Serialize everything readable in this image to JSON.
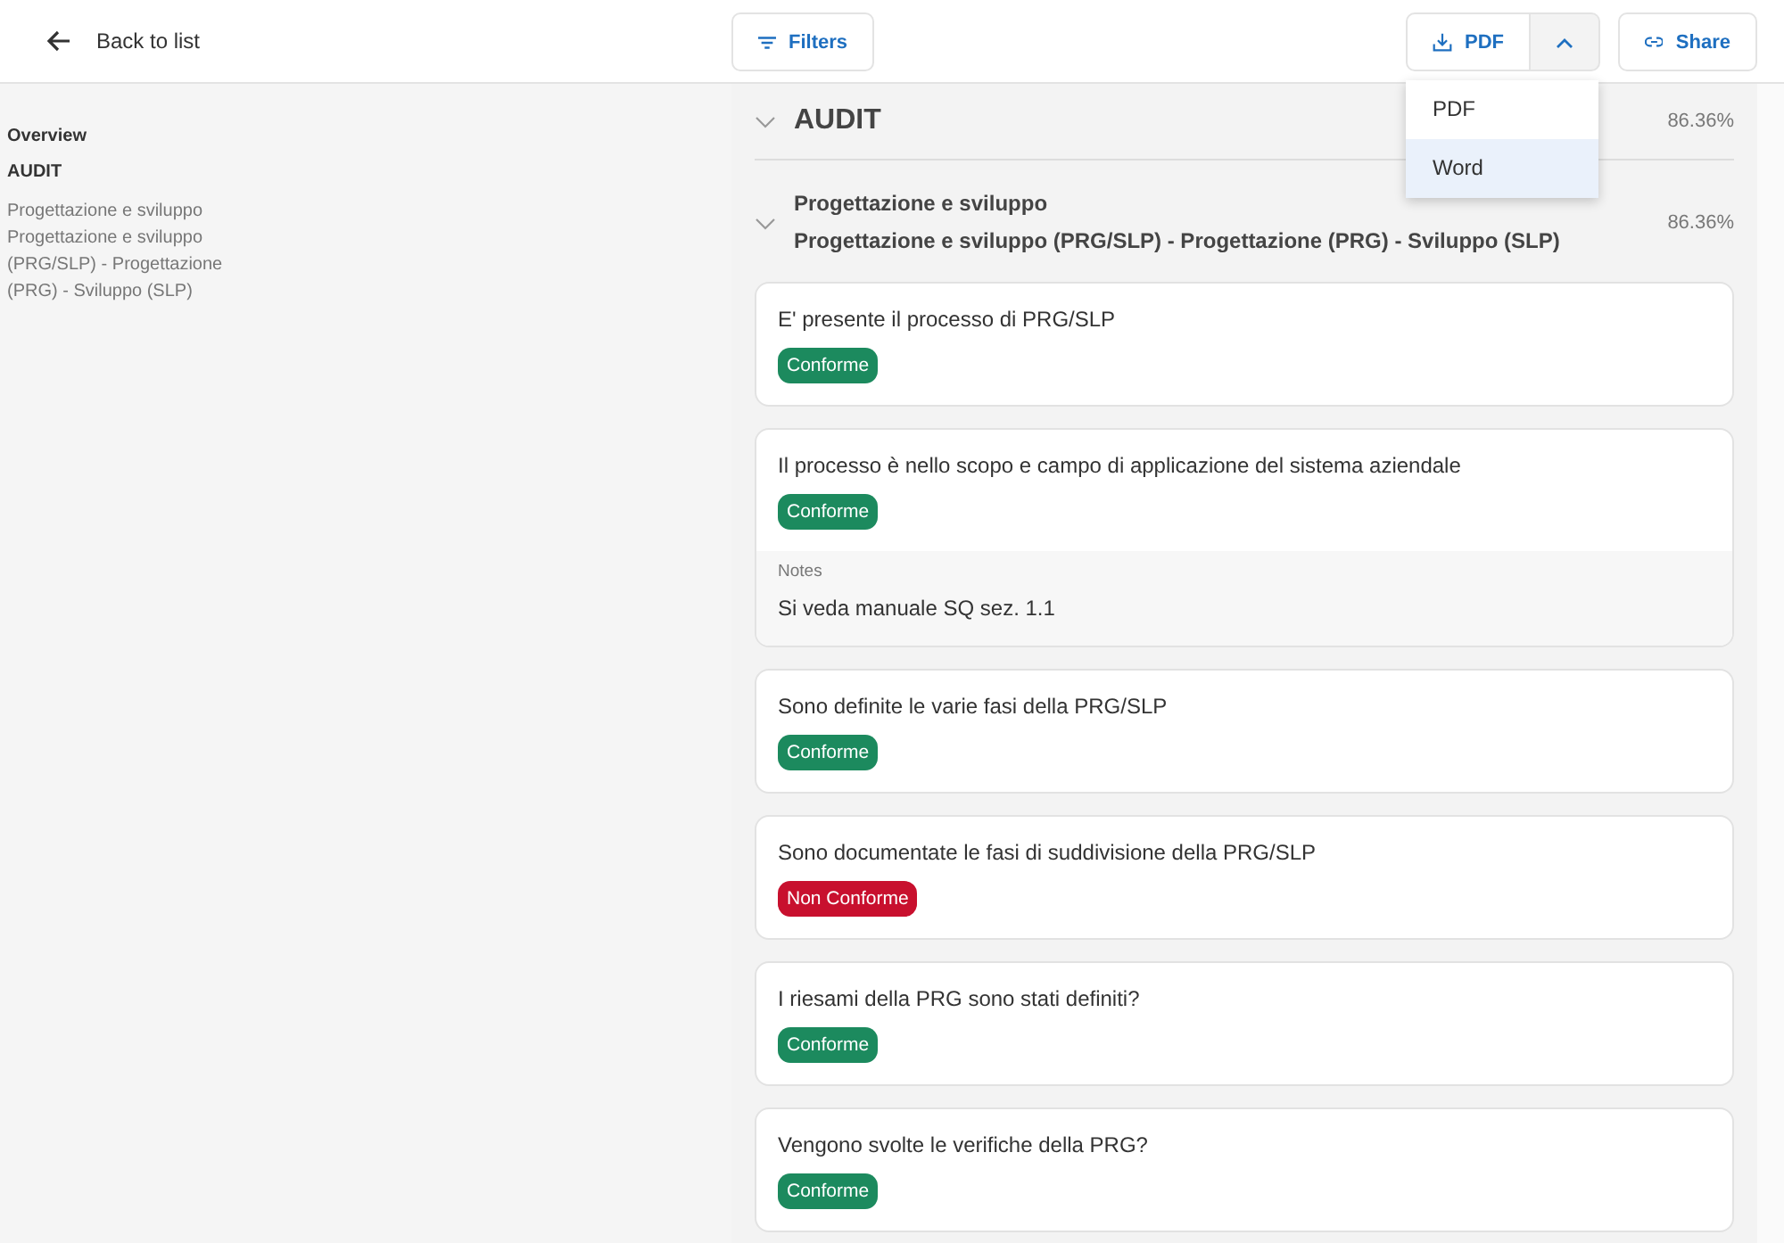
{
  "header": {
    "back": "Back to list",
    "filters": "Filters",
    "export": "PDF",
    "export_menu_open": true,
    "share": "Share"
  },
  "export_menu": [
    {
      "label": "PDF",
      "selected": false
    },
    {
      "label": "Word",
      "selected": true
    }
  ],
  "sidebar": {
    "items": [
      {
        "label": "Overview",
        "kind": "heading"
      },
      {
        "label": "AUDIT",
        "kind": "heading"
      },
      {
        "label": "Progettazione e sviluppo Progettazione e sviluppo (PRG/SLP) - Progettazione (PRG) - Sviluppo (SLP)",
        "kind": "link"
      }
    ]
  },
  "section": {
    "title": "AUDIT",
    "score": "86.36%",
    "expanded": true,
    "subsection": {
      "title": "Progettazione e sviluppo",
      "subtitle": "Progettazione e sviluppo (PRG/SLP) - Progettazione (PRG) - Sviluppo (SLP)",
      "score": "86.36%",
      "expanded": true
    }
  },
  "questions": [
    {
      "text": "E' presente il processo di PRG/SLP",
      "status": {
        "label": "Conforme",
        "kind": "ok"
      }
    },
    {
      "text": "Il processo è nello scopo e campo di applicazione del sistema aziendale",
      "status": {
        "label": "Conforme",
        "kind": "ok"
      },
      "notes_label": "Notes",
      "notes": "Si veda manuale SQ sez. 1.1"
    },
    {
      "text": "Sono definite le varie fasi della PRG/SLP",
      "status": {
        "label": "Conforme",
        "kind": "ok"
      }
    },
    {
      "text": "Sono documentate le fasi di suddivisione della PRG/SLP",
      "status": {
        "label": "Non Conforme",
        "kind": "ko"
      }
    },
    {
      "text": "I riesami della PRG sono stati definiti?",
      "status": {
        "label": "Conforme",
        "kind": "ok"
      }
    },
    {
      "text": "Vengono svolte le verifiche della PRG?",
      "status": {
        "label": "Conforme",
        "kind": "ok"
      }
    }
  ]
}
